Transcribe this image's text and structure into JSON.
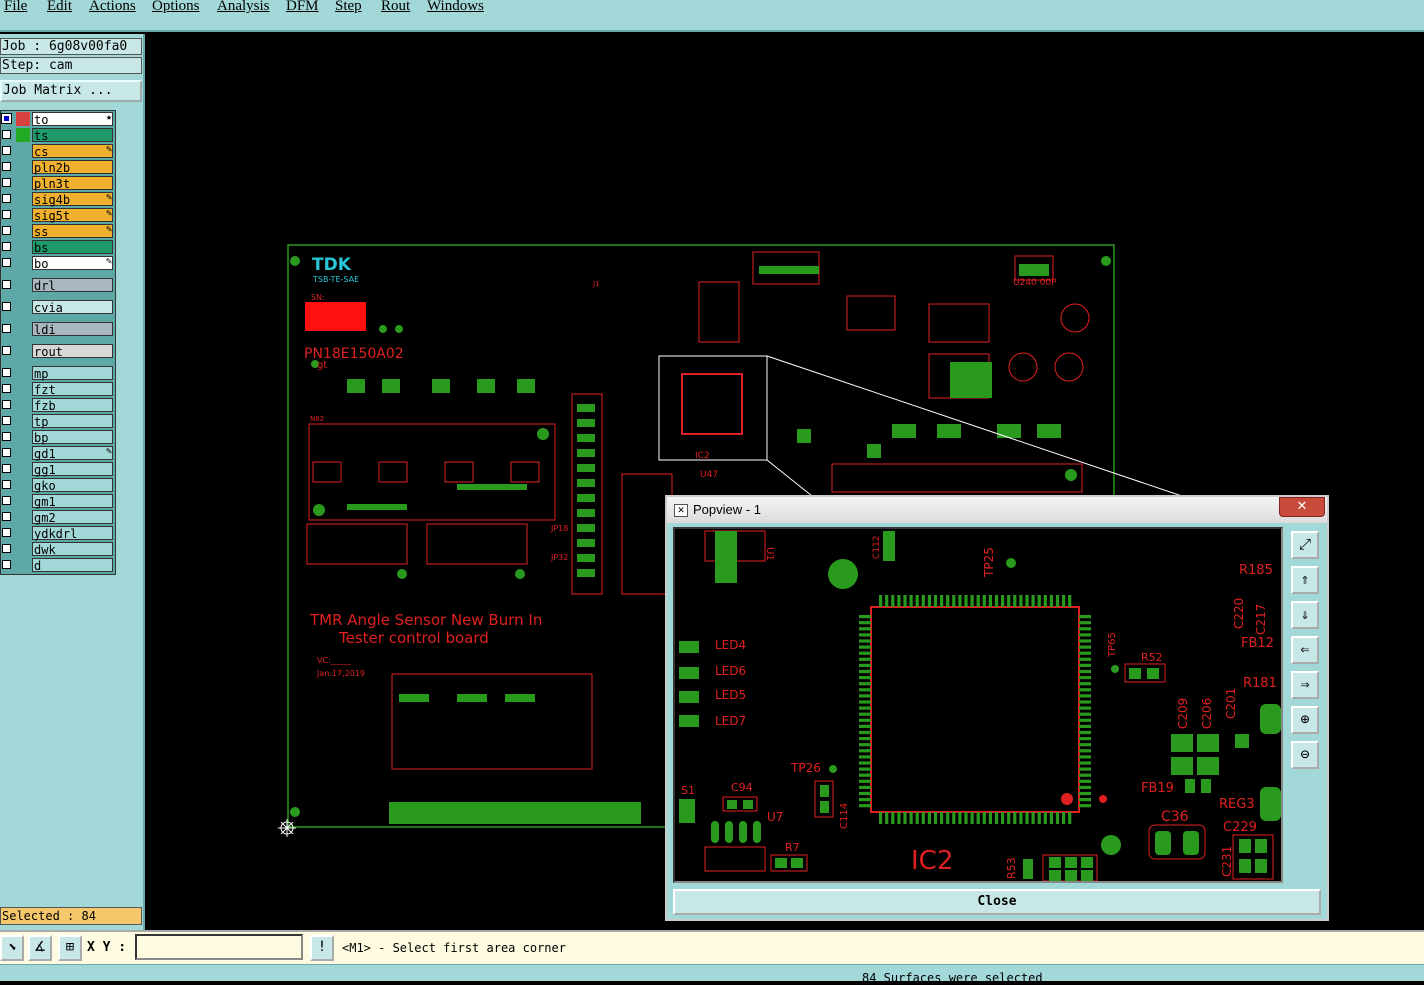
{
  "menu": [
    "File",
    "Edit",
    "Actions",
    "Options",
    "Analysis",
    "DFM",
    "Step",
    "Rout",
    "Windows"
  ],
  "job": {
    "label": "Job : 6g08v00fa0",
    "step": "Step: cam",
    "matrix_button": "Job Matrix ..."
  },
  "layers": [
    {
      "name": "to",
      "color": "#ffffff",
      "checked": true,
      "state": "#d94040",
      "mark": "★"
    },
    {
      "name": "ts",
      "color": "#1f9a6a",
      "checked": false,
      "state": "#22aa22",
      "mark": ""
    },
    {
      "name": "cs",
      "color": "#f0b030",
      "checked": false,
      "state": "",
      "mark": "✎"
    },
    {
      "name": "pln2b",
      "color": "#f0b030",
      "checked": false,
      "state": "",
      "mark": ""
    },
    {
      "name": "pln3t",
      "color": "#f0b030",
      "checked": false,
      "state": "",
      "mark": ""
    },
    {
      "name": "sig4b",
      "color": "#f0b030",
      "checked": false,
      "state": "",
      "mark": "✎"
    },
    {
      "name": "sig5t",
      "color": "#f0b030",
      "checked": false,
      "state": "",
      "mark": "✎"
    },
    {
      "name": "ss",
      "color": "#f0b030",
      "checked": false,
      "state": "",
      "mark": "✎"
    },
    {
      "name": "bs",
      "color": "#1f9a6a",
      "checked": false,
      "state": "",
      "mark": ""
    },
    {
      "name": "bo",
      "color": "#ffffff",
      "checked": false,
      "state": "",
      "mark": "✎"
    },
    {
      "name": "drl",
      "color": "#a9b8c0",
      "checked": false,
      "state": "",
      "mark": ""
    },
    {
      "name": "cvia",
      "color": "#c8e8e8",
      "checked": false,
      "state": "",
      "mark": ""
    },
    {
      "name": "ldi",
      "color": "#a9b8c0",
      "checked": false,
      "state": "",
      "mark": ""
    },
    {
      "name": "rout",
      "color": "#d8d8d8",
      "checked": false,
      "state": "",
      "mark": ""
    },
    {
      "name": "mp",
      "color": "#a3d8d8",
      "checked": false,
      "state": "",
      "mark": ""
    },
    {
      "name": "fzt",
      "color": "#a3d8d8",
      "checked": false,
      "state": "",
      "mark": ""
    },
    {
      "name": "fzb",
      "color": "#a3d8d8",
      "checked": false,
      "state": "",
      "mark": ""
    },
    {
      "name": "tp",
      "color": "#a3d8d8",
      "checked": false,
      "state": "",
      "mark": ""
    },
    {
      "name": "bp",
      "color": "#a3d8d8",
      "checked": false,
      "state": "",
      "mark": ""
    },
    {
      "name": "gd1",
      "color": "#a3d8d8",
      "checked": false,
      "state": "",
      "mark": "✎"
    },
    {
      "name": "gg1",
      "color": "#a3d8d8",
      "checked": false,
      "state": "",
      "mark": ""
    },
    {
      "name": "gko",
      "color": "#a3d8d8",
      "checked": false,
      "state": "",
      "mark": ""
    },
    {
      "name": "gm1",
      "color": "#a3d8d8",
      "checked": false,
      "state": "",
      "mark": ""
    },
    {
      "name": "gm2",
      "color": "#a3d8d8",
      "checked": false,
      "state": "",
      "mark": ""
    },
    {
      "name": "ydkdrl",
      "color": "#a3d8d8",
      "checked": false,
      "state": "",
      "mark": ""
    },
    {
      "name": "dwk",
      "color": "#a3d8d8",
      "checked": false,
      "state": "",
      "mark": ""
    },
    {
      "name": "d",
      "color": "#a3d8d8",
      "checked": false,
      "state": "",
      "mark": ""
    }
  ],
  "selected": "Selected : 84",
  "status": {
    "xy_label": "X Y :",
    "xy_value": "",
    "prompt": "<M1> - Select first area corner",
    "message": "84 Surfaces were selected"
  },
  "board": {
    "logo": "TDK",
    "logo_sub": "TSB-TE-SAE",
    "sn": "SN:",
    "part": "PN18E150A02",
    "rev": "gt",
    "title1": "TMR Angle Sensor New Burn In",
    "title2": "Tester control board",
    "vc": "VC:_____",
    "date": "Jan.17,2019",
    "lbl_u47": "U47",
    "lbl_ic2": "IC2",
    "lbl_j1": "J1",
    "lbl_jp18": "JP18",
    "lbl_jp32": "JP32",
    "lbl_u240": "U240 00P",
    "lbl_n82": "N82"
  },
  "popview": {
    "title": "Popview - 1",
    "close_x": "✕",
    "close": "Close",
    "labels": {
      "ic": "IC2",
      "led4": "LED4",
      "led6": "LED6",
      "led5": "LED5",
      "led7": "LED7",
      "tp25": "TP25",
      "tp26": "TP26",
      "tp65": "TP65",
      "r185": "R185",
      "r181": "R181",
      "r52": "R52",
      "r7": "R7",
      "r53": "R53",
      "c94": "C94",
      "c36": "C36",
      "c229": "C229",
      "c231": "C231",
      "c220": "C220",
      "c217": "C217",
      "c209": "C209",
      "c206": "C206",
      "c201": "C201",
      "c114": "C114",
      "c112": "C112",
      "fb12": "FB12",
      "fb19": "FB19",
      "reg3": "REG3",
      "u7": "U7",
      "u1": "U1",
      "s1": "S1"
    }
  },
  "colors": {
    "pad": "#2a9a1e",
    "outline": "#e02020",
    "board_edge": "#2a9a1e",
    "panel": "#a3d8d8",
    "highlight": "#f5c96b"
  }
}
